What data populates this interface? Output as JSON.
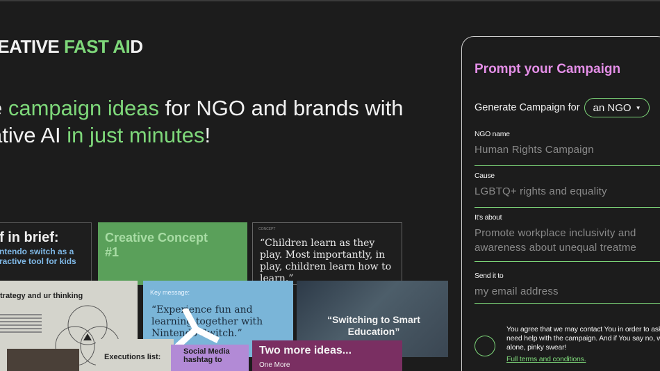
{
  "brand": {
    "part1": "REATIVE ",
    "part2": "FAST AI",
    "part3": "D"
  },
  "headline": {
    "line1_a": "e ",
    "line1_b": "campaign ideas",
    "line1_c": " for NGO and brands with",
    "line2_a": "ative AI ",
    "line2_b": "in just minutes",
    "line2_c": "!"
  },
  "collage": {
    "card1": {
      "title": "f in brief:",
      "subtitle": "ntendo switch as a ractive tool for kids"
    },
    "card2": {
      "title": "Creative Concept #1"
    },
    "card3": {
      "label": "CONCEPT",
      "quote": "“Children learn as they play. Most importantly, in play, children learn how to learn.”"
    },
    "card4": {
      "title": "trategy and ur thinking"
    },
    "card5": {
      "label": "Key message:",
      "quote": "“Experience fun and learning together with Nintendo Switch.”"
    },
    "card6": {
      "quote": "“Switching to Smart Education”"
    },
    "card7": {
      "title": "Executions list:"
    },
    "card8": {
      "title": "Social Media hashtag to"
    },
    "card9": {
      "title": "Two more ideas...",
      "subtitle": "One More"
    }
  },
  "panel": {
    "title": "Prompt your Campaign",
    "generate_label": "Generate Campaign for",
    "select_value": "an NGO",
    "fields": {
      "ngo_name": {
        "label": "NGO name",
        "placeholder": "Human Rights Campaign"
      },
      "cause": {
        "label": "Cause",
        "placeholder": "LGBTQ+ rights and equality"
      },
      "about": {
        "label": "It's about",
        "placeholder_line1": "Promote workplace inclusivity and",
        "placeholder_line2": "awareness about unequal treatme"
      },
      "send": {
        "label": "Send it to",
        "placeholder": "my email address"
      }
    },
    "consent": "You agree that we may contact You in order to ask need help with the campaign. And if You say no, w alone, pinky swear!",
    "terms_link": "Full terms and conditions."
  },
  "colors": {
    "accent_green": "#7ed87a",
    "accent_pink": "#e58fe8",
    "background": "#1c1c1c"
  }
}
